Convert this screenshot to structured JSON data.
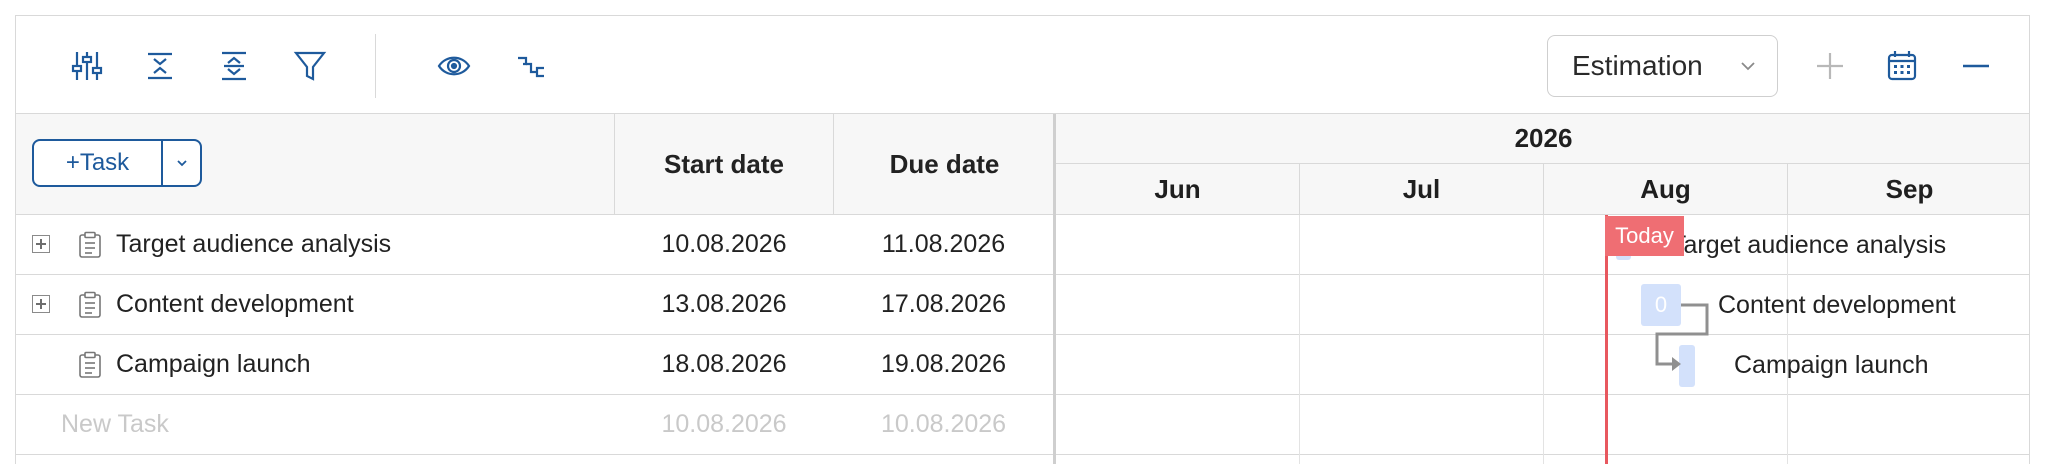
{
  "toolbar": {
    "icons": [
      "column-settings-icon",
      "collapse-all-icon",
      "expand-all-icon",
      "filter-icon",
      "view-icon",
      "dependency-icon"
    ],
    "view_select": {
      "value": "Estimation"
    },
    "right_icons": [
      "add-icon",
      "calendar-icon",
      "zoom-out-icon"
    ]
  },
  "grid": {
    "add_task_label": "+Task",
    "columns": {
      "start": "Start date",
      "due": "Due date"
    }
  },
  "timeline": {
    "year": "2026",
    "months": [
      "Jun",
      "Jul",
      "Aug",
      "Sep"
    ],
    "today_label": "Today"
  },
  "tasks": [
    {
      "name": "Target audience analysis",
      "start": "10.08.2026",
      "due": "11.08.2026",
      "expandable": true
    },
    {
      "name": "Content development",
      "start": "13.08.2026",
      "due": "17.08.2026",
      "expandable": true,
      "bar_text": "0"
    },
    {
      "name": "Campaign launch",
      "start": "18.08.2026",
      "due": "19.08.2026",
      "expandable": false
    }
  ],
  "new_task": {
    "name": "New Task",
    "start": "10.08.2026",
    "due": "10.08.2026"
  },
  "colors": {
    "accent": "#1e5a9c",
    "today": "#e8585f",
    "bar": "#d3e1fb"
  }
}
